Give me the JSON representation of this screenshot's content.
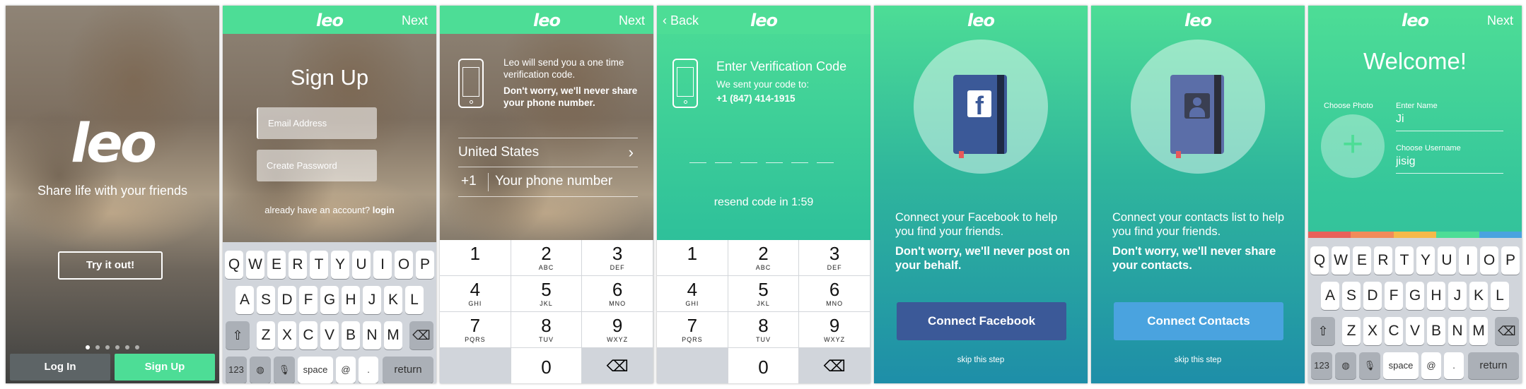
{
  "s1": {
    "logo": "leo",
    "tagline": "Share life with your friends",
    "try": "Try it out!",
    "login": "Log In",
    "signup": "Sign Up"
  },
  "s2": {
    "logo": "leo",
    "next": "Next",
    "title": "Sign Up",
    "email_ph": "Email Address",
    "pwd_ph": "Create Password",
    "already": "already have an account?",
    "login": "login"
  },
  "s3": {
    "logo": "leo",
    "next": "Next",
    "info1": "Leo will send you a one time verification code.",
    "info2": "Don't worry, we'll never share your phone number.",
    "country": "United States",
    "code": "+1",
    "phone_ph": "Your phone number"
  },
  "s4": {
    "logo": "leo",
    "back": "Back",
    "title": "Enter Verification Code",
    "sent": "We sent your code to:",
    "phone": "+1 (847) 414-1915",
    "resend": "resend code in 1:59"
  },
  "s5": {
    "logo": "leo",
    "t1": "Connect your Facebook to help you find your friends.",
    "t2": "Don't worry, we'll never post on your behalf.",
    "cta": "Connect Facebook",
    "skip": "skip this step",
    "icon": "f"
  },
  "s6": {
    "logo": "leo",
    "t1": "Connect your contacts list to help you find your friends.",
    "t2": "Don't worry, we'll never share your contacts.",
    "cta": "Connect Contacts",
    "skip": "skip this step"
  },
  "s7": {
    "logo": "leo",
    "next": "Next",
    "title": "Welcome!",
    "photo_label": "Choose Photo",
    "name_label": "Enter Name",
    "name_val": "Ji",
    "user_label": "Choose Username",
    "user_val": "jisig"
  },
  "keyboard": {
    "row1": [
      "Q",
      "W",
      "E",
      "R",
      "T",
      "Y",
      "U",
      "I",
      "O",
      "P"
    ],
    "row2": [
      "A",
      "S",
      "D",
      "F",
      "G",
      "H",
      "J",
      "K",
      "L"
    ],
    "row3": [
      "Z",
      "X",
      "C",
      "V",
      "B",
      "N",
      "M"
    ],
    "k123": "123",
    "space": "space",
    "at": "@",
    "dot": ".",
    "ret": "return"
  },
  "numpad": [
    {
      "n": "1",
      "l": ""
    },
    {
      "n": "2",
      "l": "ABC"
    },
    {
      "n": "3",
      "l": "DEF"
    },
    {
      "n": "4",
      "l": "GHI"
    },
    {
      "n": "5",
      "l": "JKL"
    },
    {
      "n": "6",
      "l": "MNO"
    },
    {
      "n": "7",
      "l": "PQRS"
    },
    {
      "n": "8",
      "l": "TUV"
    },
    {
      "n": "9",
      "l": "WXYZ"
    },
    {
      "n": "0",
      "l": ""
    }
  ],
  "colors": {
    "green": "#4ddd96",
    "fb": "#3b5998",
    "contacts": "#4a90d9",
    "stripe": [
      "#e8615a",
      "#f28b5a",
      "#f5b94a",
      "#4ddd96",
      "#4aa3df"
    ]
  }
}
